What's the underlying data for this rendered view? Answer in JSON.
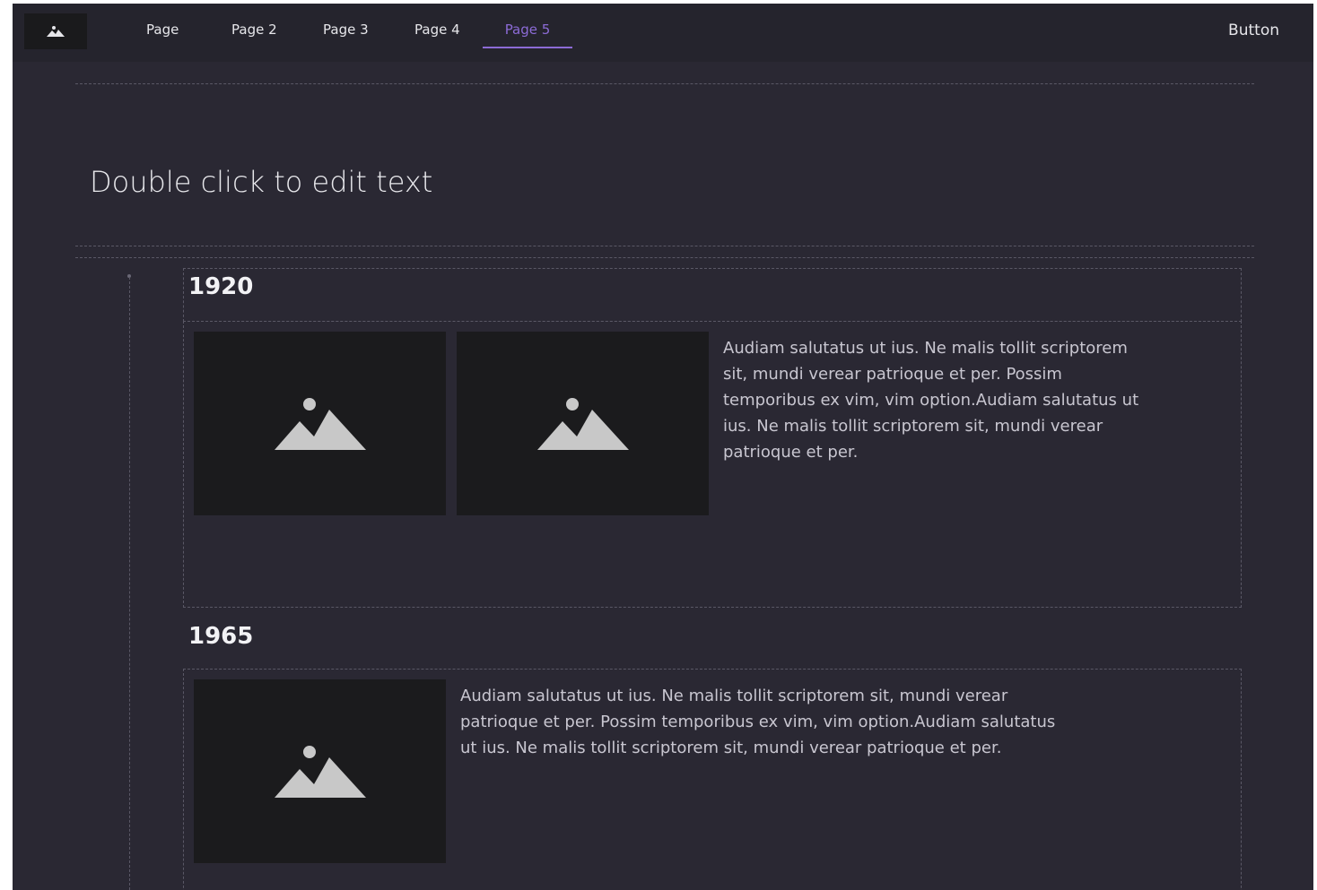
{
  "nav": {
    "logo_icon": "image-icon",
    "items": [
      {
        "label": "Page",
        "active": false
      },
      {
        "label": "Page 2",
        "active": false
      },
      {
        "label": "Page 3",
        "active": false
      },
      {
        "label": "Page 4",
        "active": false
      },
      {
        "label": "Page 5",
        "active": true
      }
    ],
    "button_label": "Button"
  },
  "hero": {
    "title": "Double click to edit text"
  },
  "timeline": {
    "entries": [
      {
        "year": "1920",
        "images": [
          "image-placeholder-icon",
          "image-placeholder-icon"
        ],
        "text": "Audiam salutatus ut ius. Ne malis tollit scriptorem sit, mundi verear patrioque et per. Possim temporibus ex vim, vim option.Audiam salutatus ut ius. Ne malis tollit scriptorem sit, mundi verear patrioque et per."
      },
      {
        "year": "1965",
        "images": [
          "image-placeholder-icon"
        ],
        "text": "Audiam salutatus ut ius. Ne malis tollit scriptorem sit, mundi verear patrioque et per. Possim temporibus ex vim, vim option.Audiam salutatus ut ius. Ne malis tollit scriptorem sit, mundi verear patrioque et per."
      }
    ]
  },
  "colors": {
    "background": "#2a2833",
    "topbar": "#25242d",
    "accent": "#8c6bd6",
    "image_placeholder": "#1b1b1d"
  }
}
